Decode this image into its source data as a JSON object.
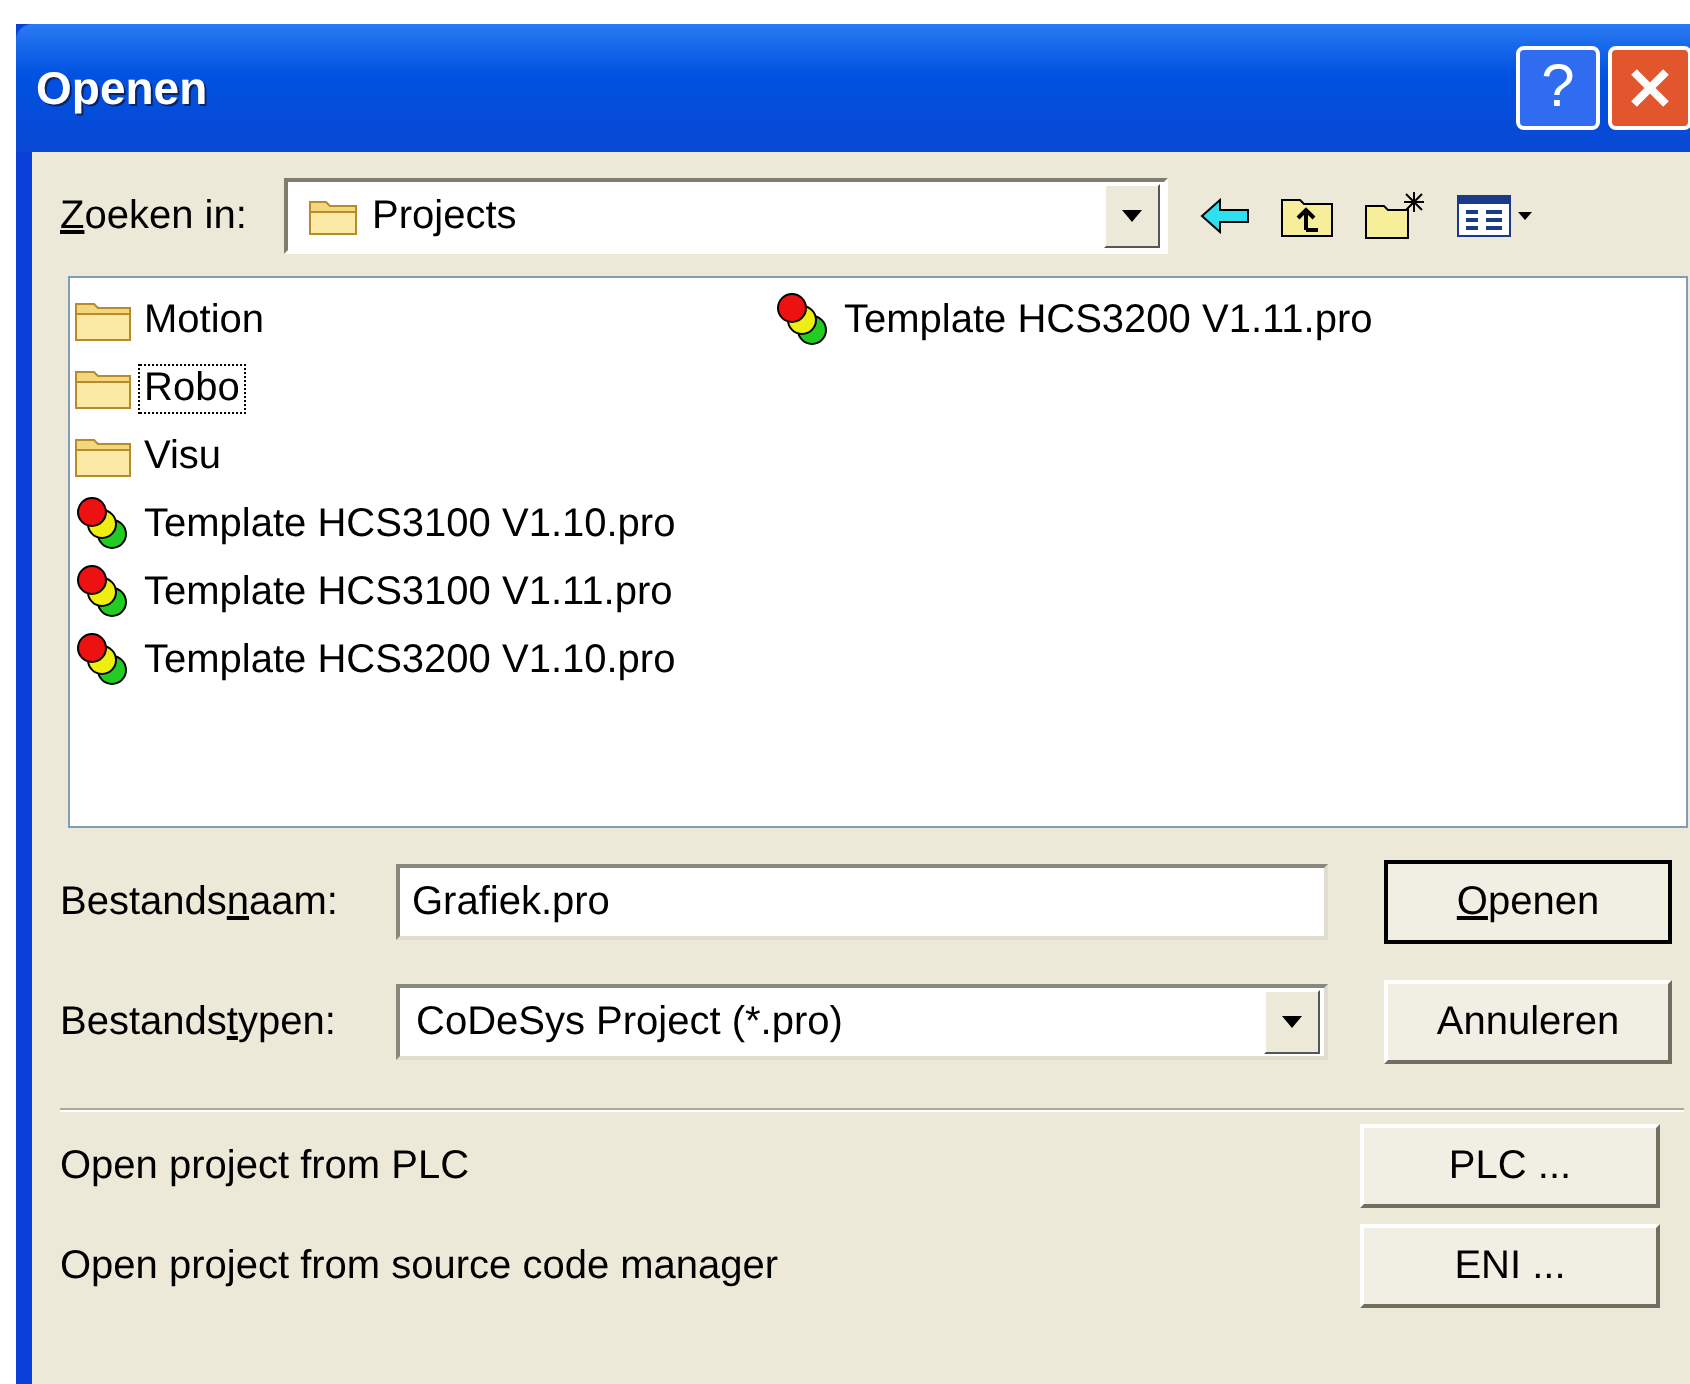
{
  "window": {
    "title": "Openen",
    "help_button": "?"
  },
  "look_in": {
    "label": {
      "accel": "Z",
      "after": "oeken in:"
    },
    "value": "Projects"
  },
  "files": [
    {
      "name": "Motion",
      "kind": "folder",
      "focused": false
    },
    {
      "name": "Robo",
      "kind": "folder",
      "focused": true
    },
    {
      "name": "Visu",
      "kind": "folder",
      "focused": false
    },
    {
      "name": "Template HCS3100 V1.10.pro",
      "kind": "project",
      "focused": false
    },
    {
      "name": "Template HCS3100 V1.11.pro",
      "kind": "project",
      "focused": false
    },
    {
      "name": "Template HCS3200 V1.10.pro",
      "kind": "project",
      "focused": false
    },
    {
      "name": "Template HCS3200 V1.11.pro",
      "kind": "project",
      "focused": false
    }
  ],
  "file_name": {
    "label": {
      "before": "Bestands",
      "accel": "n",
      "after": "aam:"
    },
    "value": "Grafiek.pro"
  },
  "file_type": {
    "label": {
      "before": "Bestands",
      "accel": "t",
      "after": "ypen:"
    },
    "value": "CoDeSys Project (*.pro)"
  },
  "buttons": [
    {
      "accel": "O",
      "after": "penen",
      "default": true
    },
    {
      "after": "Annuleren",
      "default": false
    }
  ],
  "extra": [
    {
      "text": "Open project from PLC",
      "button": "PLC ..."
    },
    {
      "text": "Open project from source code manager",
      "button": "ENI ..."
    }
  ]
}
